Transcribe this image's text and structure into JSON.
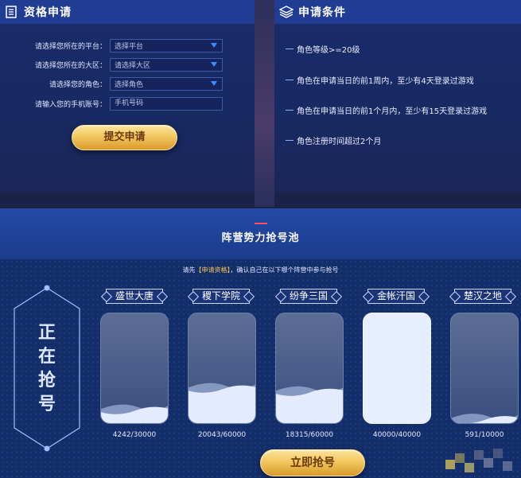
{
  "eligibility": {
    "title": "资格申请",
    "icon": "document-list-icon",
    "fields": [
      {
        "label": "请选择您所在的平台：",
        "value": "选择平台",
        "type": "select"
      },
      {
        "label": "请选择您所在的大区：",
        "value": "请选择大区",
        "type": "select"
      },
      {
        "label": "请选择您的角色：",
        "value": "选择角色",
        "type": "select"
      },
      {
        "label": "请输入您的手机账号：",
        "placeholder": "手机号码",
        "type": "input"
      }
    ],
    "submit_label": "提交申请"
  },
  "conditions": {
    "title": "申请条件",
    "icon": "layers-icon",
    "items": [
      "角色等级>=20级",
      "角色在申请当日的前1周内，至少有4天登录过游戏",
      "角色在申请当日的前1个月内，至少有15天登录过游戏",
      "角色注册时间超过2个月"
    ]
  },
  "pool": {
    "title": "阵营势力抢号池",
    "notice_prefix": "请先",
    "notice_highlight": "【申请资格】",
    "notice_suffix": "，确认自己在以下哪个阵营中参与抢号",
    "status": "正在抢号",
    "camps": [
      {
        "name": "盛世大唐",
        "count": "4242/30000",
        "fill": 0.1414
      },
      {
        "name": "稷下学院",
        "count": "20043/60000",
        "fill": 0.334
      },
      {
        "name": "纷争三国",
        "count": "18315/60000",
        "fill": 0.305
      },
      {
        "name": "金帐汗国",
        "count": "40000/40000",
        "fill": 1.0
      },
      {
        "name": "楚汉之地",
        "count": "591/10000",
        "fill": 0.059
      }
    ],
    "grab_label": "立即抢号"
  },
  "colors": {
    "accent_gold": "#f3c760",
    "highlight": "#f5c451",
    "panel_header": "#203c93",
    "accent_red": "#ff4d5c"
  }
}
